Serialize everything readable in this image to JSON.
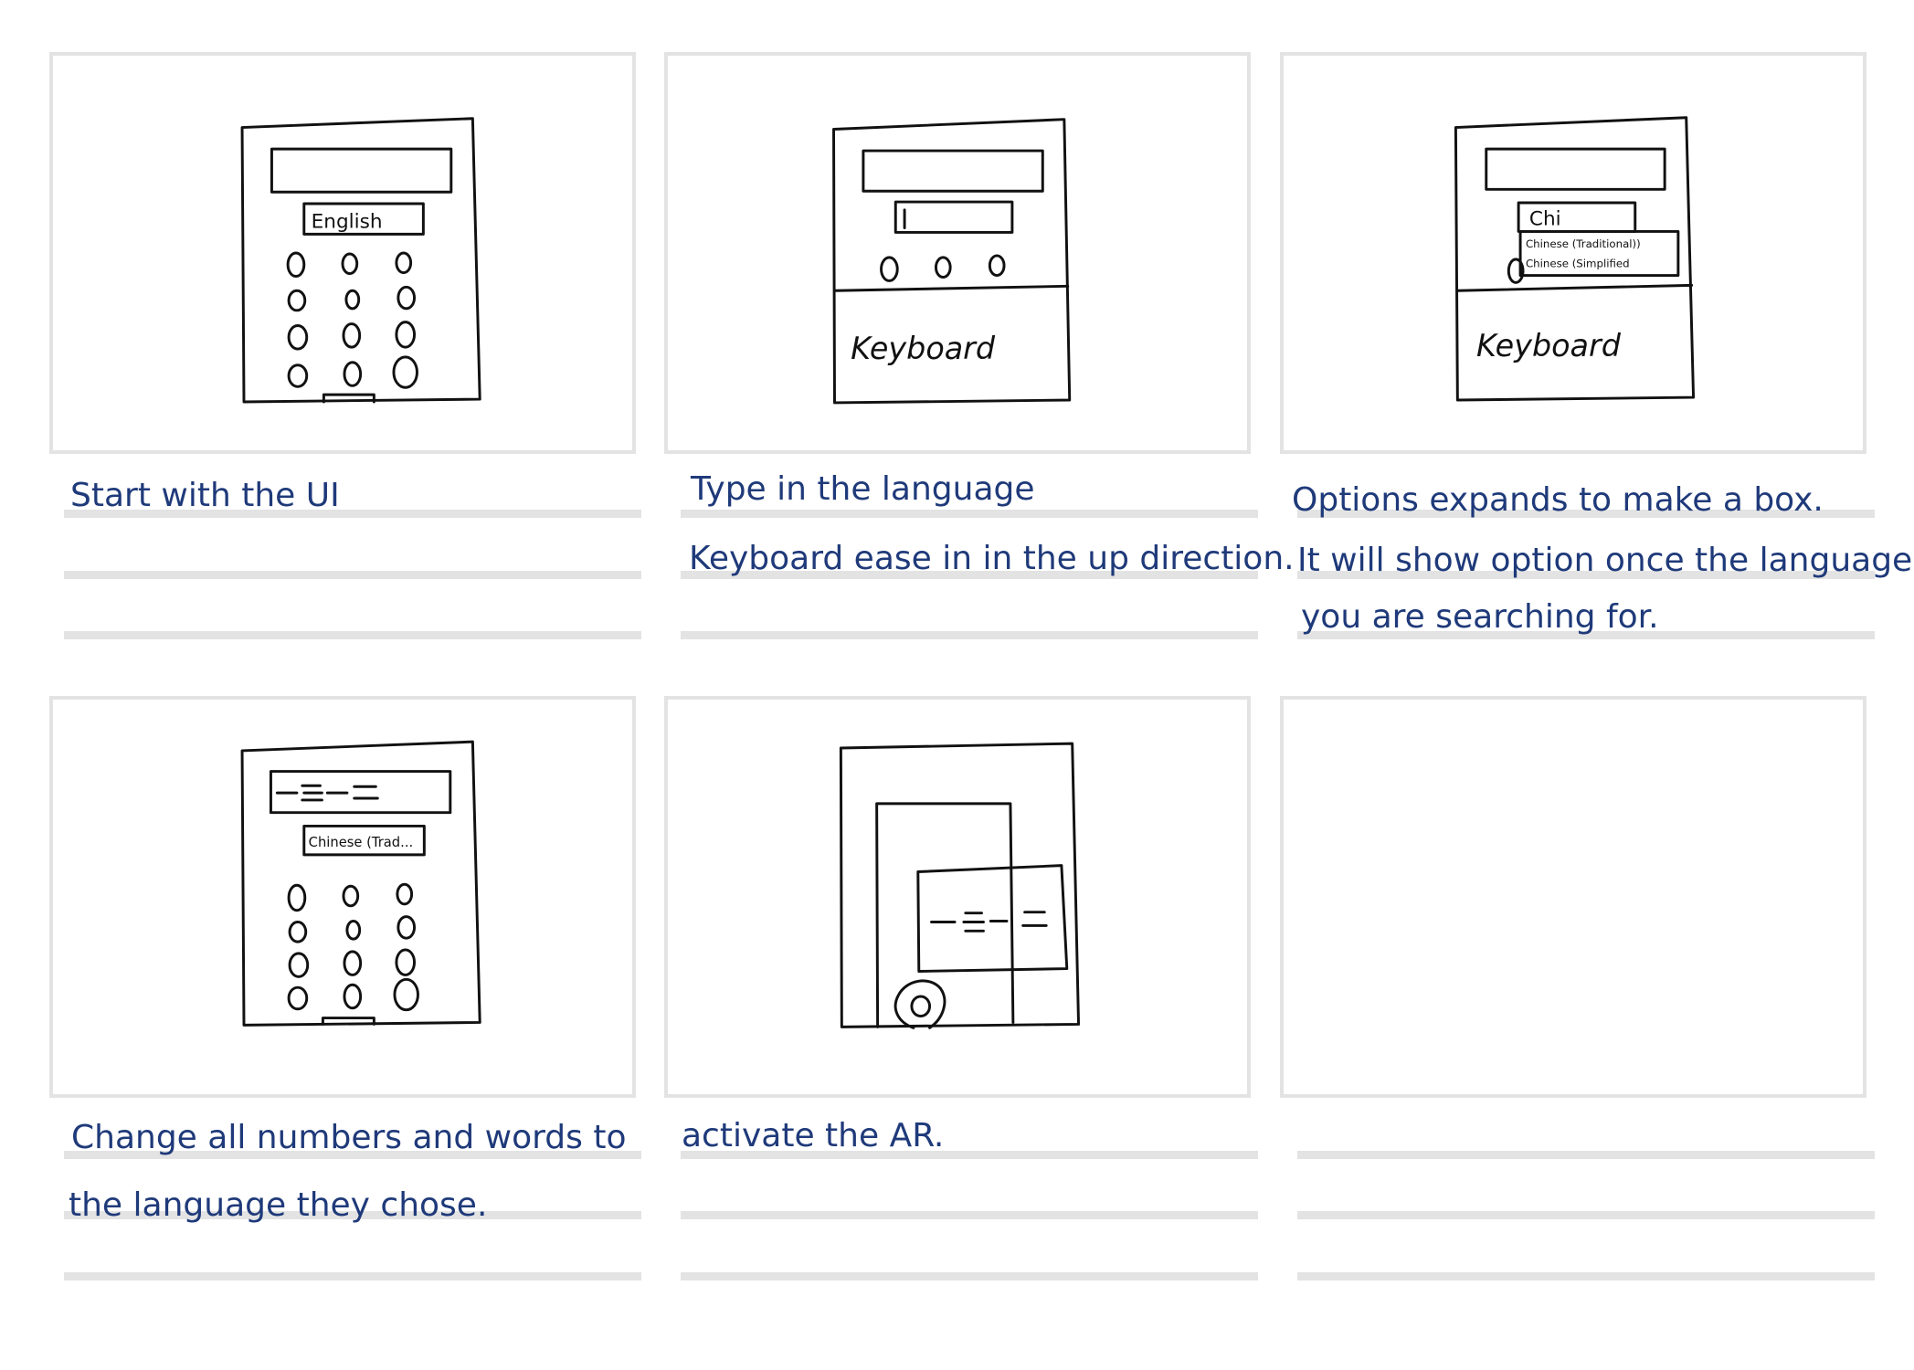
{
  "panels": [
    {
      "sketch": {
        "label": "English"
      },
      "captions": [
        "Start with the UI"
      ]
    },
    {
      "sketch": {
        "keyboard": "Keyboard"
      },
      "captions": [
        "Type in the language",
        "Keyboard ease in in the up direction."
      ]
    },
    {
      "sketch": {
        "input": "Chi",
        "option1": "Chinese (Traditional))",
        "option2": "Chinese (Simplified",
        "keyboard": "Keyboard"
      },
      "captions": [
        "Options expands to make a box.",
        "It will show option once the language",
        "you are searching for."
      ]
    },
    {
      "sketch": {
        "label": "Chinese (Trad..."
      },
      "captions": [
        "Change all numbers and words to",
        "the language they chose."
      ]
    },
    {
      "sketch": {},
      "captions": [
        "activate the AR."
      ]
    },
    {
      "sketch": {},
      "captions": []
    }
  ]
}
